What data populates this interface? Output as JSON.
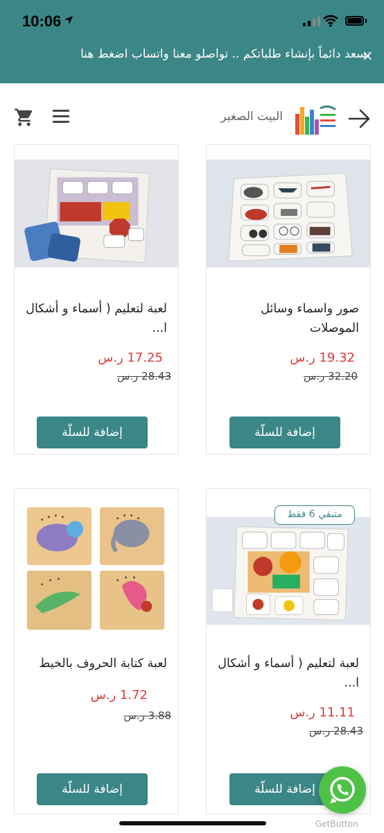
{
  "status_bar": {
    "time": "10:06"
  },
  "banner": {
    "text": "نسعد دائماً بإنشاء طلباتكم .. تواصلو معنا واتساب اضغط هنا",
    "close_label": "×"
  },
  "header": {
    "store_name": "البيت الصغير"
  },
  "products": [
    {
      "title": "صور واسماء وسائل الموصلات",
      "price": "19.32 ر.س",
      "old_price": "32.20 ر.س",
      "button": "إضافة للسلّة"
    },
    {
      "title": "لعبة لتعليم ( أسماء و أشكال ا...",
      "price": "17.25 ر.س",
      "old_price": "28.43 ر.س",
      "button": "إضافة للسلّة"
    },
    {
      "title": "لعبة لتعليم ( أسماء و أشكال ا...",
      "price": "11.11 ر.س",
      "old_price": "28.43 ر.س",
      "button": "إضافة للسلّة",
      "badge": "متبقي 6 فقط"
    },
    {
      "title": "لعبة كتابة الحروف بالخيط",
      "price": "1.72 ر.س",
      "old_price": "3.88 ر.س",
      "button": "إضافة للسلّة"
    }
  ],
  "whatsapp": {
    "brand": "GetButton"
  },
  "colors": {
    "brand": "#3b8686",
    "sale_price": "#d93a3a",
    "whatsapp": "#4dc247"
  }
}
